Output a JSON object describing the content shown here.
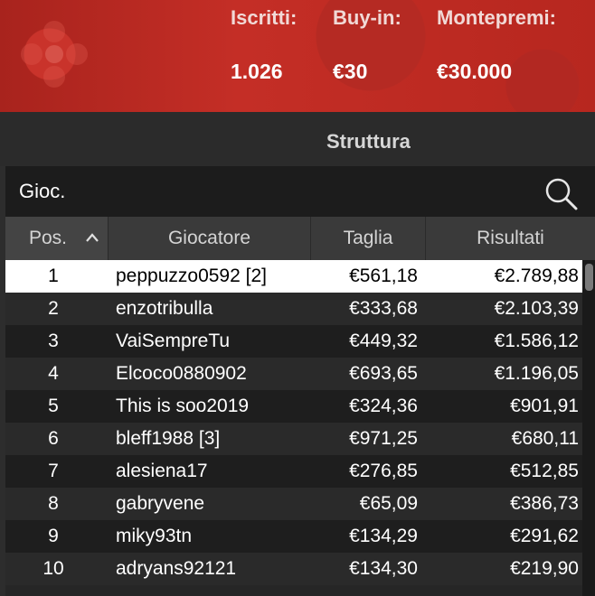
{
  "header": {
    "stats": [
      {
        "label": "Iscritti:",
        "value": "1.026"
      },
      {
        "label": "Buy-in:",
        "value": "€30"
      },
      {
        "label": "Montepremi:",
        "value": "€30.000"
      }
    ]
  },
  "tabs": {
    "active": "Struttura"
  },
  "search": {
    "label": "Gioc.",
    "icon": "search-icon"
  },
  "table": {
    "columns": [
      "Pos.",
      "Giocatore",
      "Taglia",
      "Risultati"
    ],
    "sort_icon": "chevron-up-icon",
    "rows": [
      {
        "pos": "1",
        "player": "peppuzzo0592 [2]",
        "stack": "€561,18",
        "result": "€2.789,88"
      },
      {
        "pos": "2",
        "player": "enzotribulla",
        "stack": "€333,68",
        "result": "€2.103,39"
      },
      {
        "pos": "3",
        "player": "VaiSempreTu",
        "stack": "€449,32",
        "result": "€1.586,12"
      },
      {
        "pos": "4",
        "player": "Elcoco0880902",
        "stack": "€693,65",
        "result": "€1.196,05"
      },
      {
        "pos": "5",
        "player": "This is soo2019",
        "stack": "€324,36",
        "result": "€901,91"
      },
      {
        "pos": "6",
        "player": "bleff1988 [3]",
        "stack": "€971,25",
        "result": "€680,11"
      },
      {
        "pos": "7",
        "player": "alesiena17",
        "stack": "€276,85",
        "result": "€512,85"
      },
      {
        "pos": "8",
        "player": "gabryvene",
        "stack": "€65,09",
        "result": "€386,73"
      },
      {
        "pos": "9",
        "player": "miky93tn",
        "stack": "€134,29",
        "result": "€291,62"
      },
      {
        "pos": "10",
        "player": "adryans92121",
        "stack": "€134,30",
        "result": "€219,90"
      }
    ]
  }
}
